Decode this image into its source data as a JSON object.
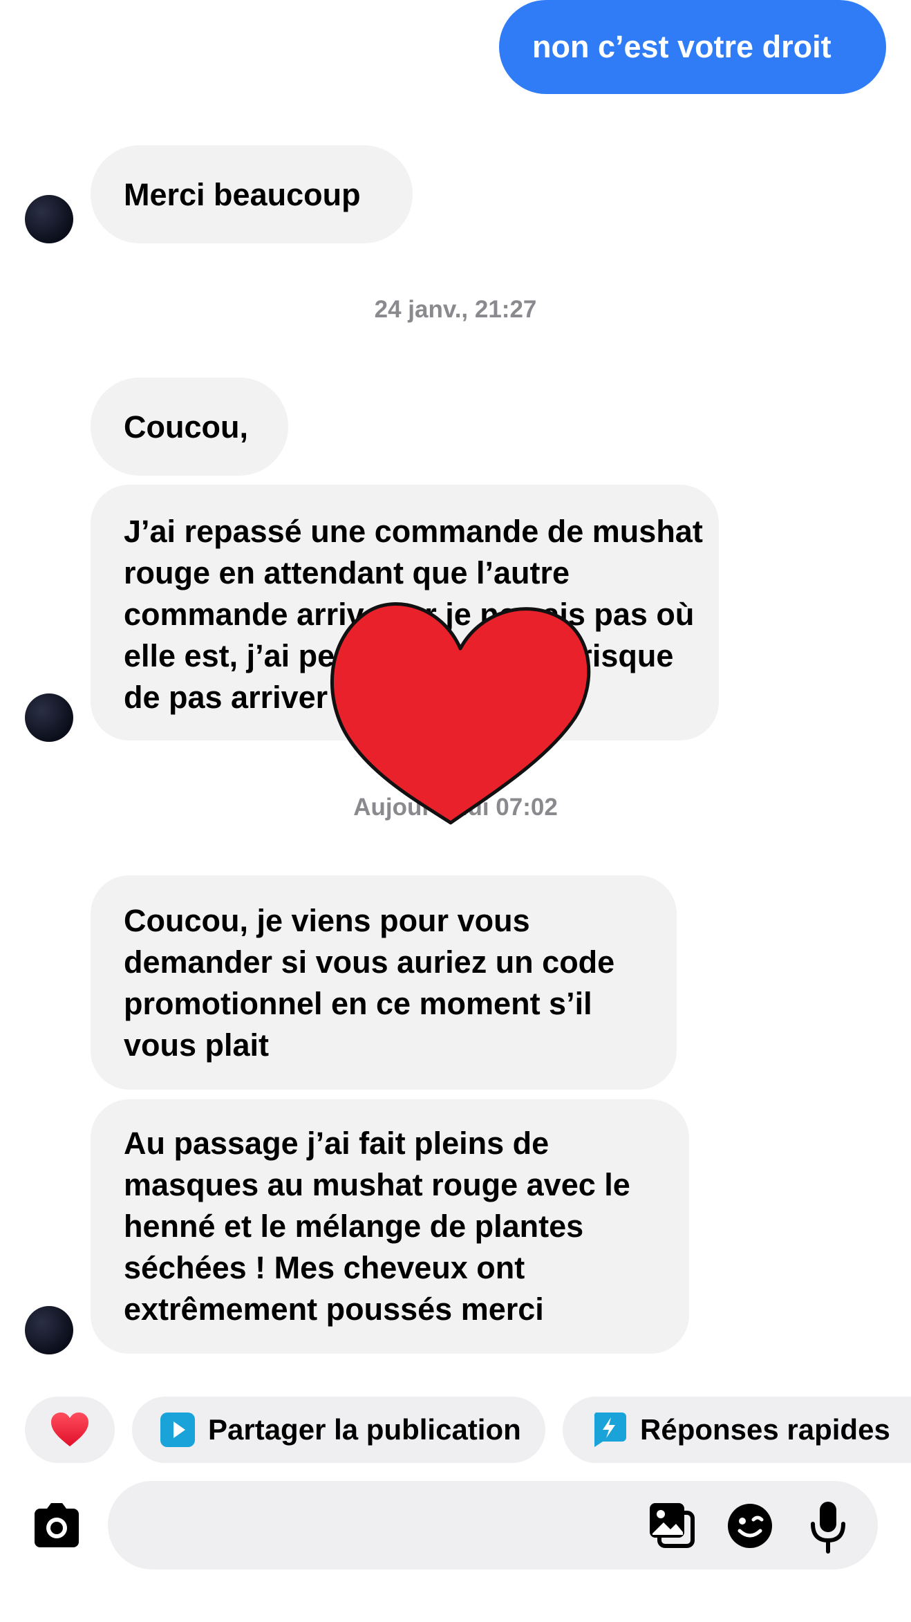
{
  "messages": {
    "out1": "non c’est votre droit",
    "in1": "Merci beaucoup",
    "timestamp1": "24 janv., 21:27",
    "in2": "Coucou,",
    "in3": "J’ai repassé une commande de mushat rouge en attendant que l’autre commande arrive car je ne sais pas où elle est, j’ai peur même que ça risque de pas arriver du tous",
    "timestamp2": "Aujourd’hui 07:02",
    "in4": "Coucou, je viens pour vous demander si vous auriez un code promotionnel en ce moment s’il vous plait",
    "in5": "Au passage j’ai fait pleins de masques au mushat rouge avec le henné et le mélange de plantes séchées ! Mes cheveux ont extrêmement poussés merci"
  },
  "quick_actions": {
    "heart_icon": "heart-icon",
    "share_label": "Partager la publication",
    "quick_replies_label": "Réponses rapides"
  },
  "composer": {
    "placeholder": "",
    "icons": [
      "camera-icon",
      "gallery-icon",
      "sticker-icon",
      "microphone-icon"
    ]
  },
  "colors": {
    "outgoing_bubble": "#2f7cf6",
    "incoming_bubble": "#f2f2f3",
    "timestamp": "#8a8a8e",
    "heart_overlay": "#e8212b",
    "share_icon": "#1aa3d9"
  }
}
